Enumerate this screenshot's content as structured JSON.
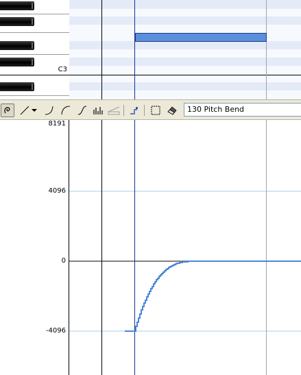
{
  "piano": {
    "octave_label": "C3"
  },
  "toolbar": {
    "tools": [
      "pencil-tool",
      "line-tool",
      "dropdown-arrow",
      "concave-curve-tool",
      "convex-curve-tool",
      "s-curve-tool",
      "random-tool",
      "scale-tool",
      "marker-tool",
      "select-tool",
      "eraser-tool"
    ],
    "controller": "130 Pitch Bend"
  },
  "axis": {
    "labels": [
      "8191",
      "4096",
      "0",
      "-4096"
    ]
  },
  "colors": {
    "note_fill": "#5b8edb",
    "curve": "#4a86d6",
    "row_dark": "#e4ebf7",
    "toolbar_bg": "#ece9d8"
  }
}
